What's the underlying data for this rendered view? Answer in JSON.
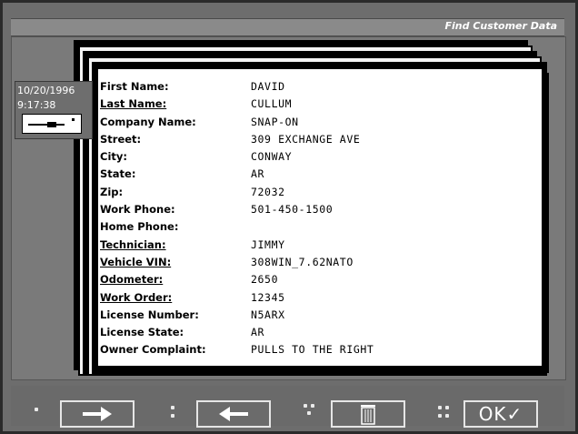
{
  "window": {
    "title": "Find Customer Data"
  },
  "clock": {
    "date": "10/20/1996",
    "time": "9:17:38"
  },
  "record": {
    "fields": [
      {
        "label": "First Name:",
        "value": "DAVID",
        "underline": false
      },
      {
        "label": "Last Name:",
        "value": "CULLUM",
        "underline": true
      },
      {
        "label": "Company Name:",
        "value": "SNAP-ON",
        "underline": false
      },
      {
        "label": "Street:",
        "value": "309 EXCHANGE AVE",
        "underline": false
      },
      {
        "label": "City:",
        "value": "CONWAY",
        "underline": false
      },
      {
        "label": "State:",
        "value": "AR",
        "underline": false
      },
      {
        "label": "Zip:",
        "value": "72032",
        "underline": false
      },
      {
        "label": "Work Phone:",
        "value": "501-450-1500",
        "underline": false
      },
      {
        "label": "Home Phone:",
        "value": "",
        "underline": false
      },
      {
        "label": "Technician:",
        "value": "JIMMY",
        "underline": true
      },
      {
        "label": "Vehicle VIN:",
        "value": "308WIN_7.62NATO",
        "underline": true
      },
      {
        "label": "Odometer:",
        "value": "2650",
        "underline": true
      },
      {
        "label": "Work Order:",
        "value": "12345",
        "underline": true
      },
      {
        "label": "License Number:",
        "value": "N5ARX",
        "underline": false
      },
      {
        "label": "License State:",
        "value": "AR",
        "underline": false
      },
      {
        "label": "Owner Complaint:",
        "value": "PULLS TO THE RIGHT",
        "underline": false
      }
    ]
  },
  "toolbar": {
    "buttons": [
      {
        "name": "next-button",
        "icon": "arrow-right-icon"
      },
      {
        "name": "back-button",
        "icon": "arrow-left-icon"
      },
      {
        "name": "delete-button",
        "icon": "trash-icon"
      },
      {
        "name": "ok-button",
        "label": "OK✓"
      }
    ]
  }
}
